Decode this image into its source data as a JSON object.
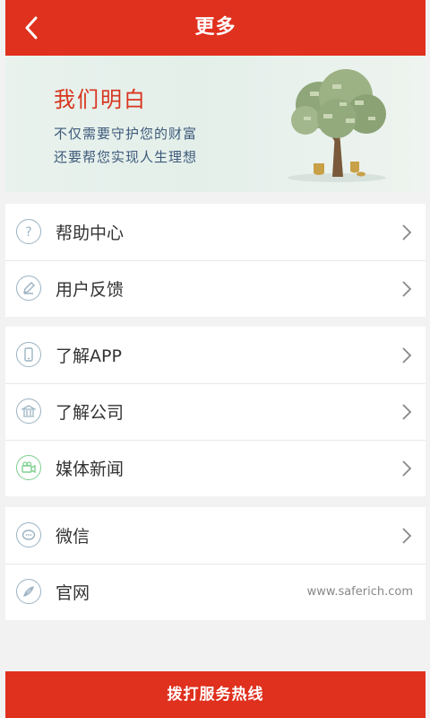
{
  "header": {
    "title": "更多"
  },
  "banner": {
    "title": "我们明白",
    "line1": "不仅需要守护您的财富",
    "line2": "还要帮您实现人生理想"
  },
  "menu": {
    "help": "帮助中心",
    "feedback": "用户反馈",
    "about_app": "了解APP",
    "about_company": "了解公司",
    "media_news": "媒体新闻",
    "wechat": "微信",
    "website": "官网",
    "website_url": "www.saferich.com"
  },
  "footer": {
    "hotline_button": "拨打服务热线"
  },
  "colors": {
    "accent": "#e0301e",
    "icon_border": "#9bb3c2",
    "green_icon": "#7fcf90"
  }
}
